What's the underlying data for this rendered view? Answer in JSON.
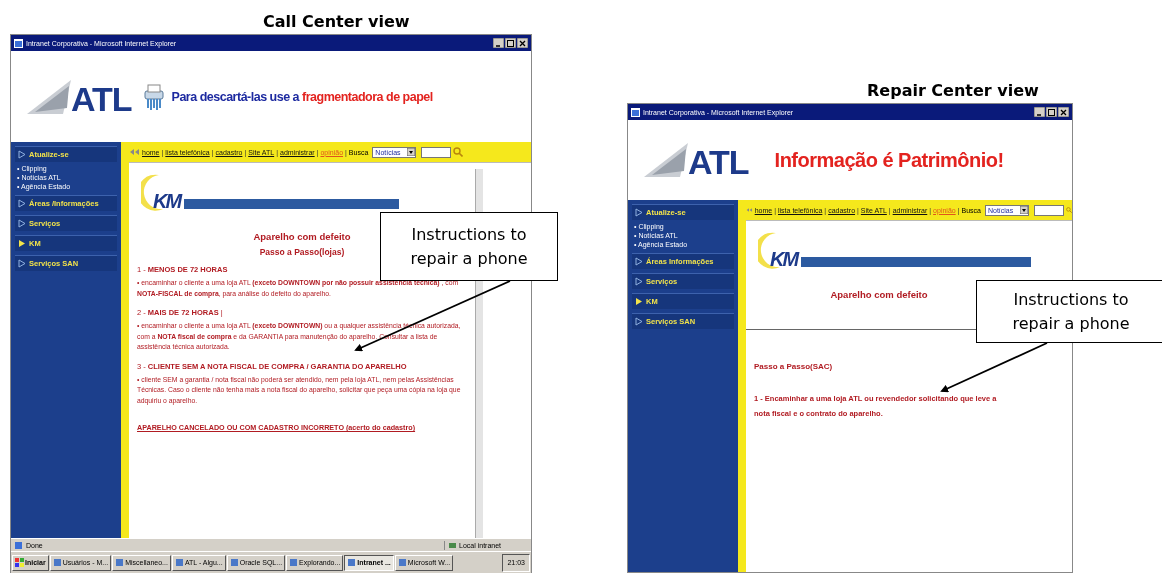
{
  "views": [
    {
      "caption": "Call Center  view",
      "window": {
        "title": "Intranet Corporativa - Microsoft Internet Explorer",
        "logo": "ATL",
        "banner": {
          "kind": "ad",
          "parts": [
            {
              "text": "Para descartá-las use a ",
              "color": "#1d2aa0"
            },
            {
              "text": "fragmentadora de papel",
              "color": "#e3231f"
            }
          ]
        },
        "sidebar": [
          {
            "label": "Atualize-se",
            "selected": false,
            "links": [
              "• Clipping",
              "• Notícias ATL",
              "• Agência Estado"
            ]
          },
          {
            "label": "Áreas /Informações",
            "selected": false
          },
          {
            "label": "Serviços",
            "selected": false
          },
          {
            "label": "KM",
            "selected": true
          },
          {
            "label": "Serviços SAN",
            "selected": false
          }
        ],
        "toolbar": {
          "separator": "|",
          "links": [
            {
              "text": "home",
              "kind": "plain"
            },
            {
              "text": "lista telefônica",
              "kind": "plain"
            },
            {
              "text": "cadastro",
              "kind": "plain"
            },
            {
              "text": "Site ATL",
              "kind": "plain"
            },
            {
              "text": "administrar",
              "kind": "plain"
            },
            {
              "text": "opinião",
              "kind": "accent"
            }
          ],
          "search_label": "Busca",
          "search_select": "Notícias"
        },
        "content": {
          "logo": "KM",
          "title": "Aparelho com defeito",
          "subtitle": "Passo a Passo(lojas)",
          "items": [
            {
              "kind": "heading",
              "text": "1 - **MENOS DE 72 HORAS**"
            },
            {
              "kind": "bullet",
              "text": "• encaminhar o cliente a uma loja ATL **(exceto DOWNTOWN por não possuir assistência técnica)** , com **NOTA-FISCAL de compra**, para análise do defeito do aparelho."
            },
            {
              "kind": "heading",
              "text": "2 - **MAIS DE 72 HORAS** |"
            },
            {
              "kind": "bullet",
              "text": "• encaminhar o cliente a uma loja ATL **(exceto DOWNTOWN)** ou a qualquer assistência técnica autorizada, com a **NOTA fiscal de compra** e da GARANTIA para manutenção do aparelho. Consultar a lista de assistência técnica autorizada."
            },
            {
              "kind": "heading",
              "text": "3 - **CLIENTE SEM A NOTA FISCAL DE COMPRA / GARANTIA DO APARELHO**"
            },
            {
              "kind": "bullet",
              "text": "• cliente SEM a garantia / nota fiscal não poderá ser atendido, nem pela loja ATL, nem pelas Assistências Técnicas. Caso o cliente não tenha mais a nota fiscal do aparelho, solicitar que peça uma cópia na loja que adquiriu o aparelho."
            }
          ],
          "link": "APARELHO CANCELADO OU COM CADASTRO INCORRETO (acerto do cadastro)"
        },
        "status_bar": {
          "text": "Done",
          "zone": "Local intranet"
        },
        "taskbar": {
          "start": "Iniciar",
          "clock": "21:03",
          "items": [
            {
              "label": "Usuários - M...",
              "selected": false
            },
            {
              "label": "Miscellaneo...",
              "selected": false
            },
            {
              "label": "ATL - Algu...",
              "selected": false
            },
            {
              "label": "Oracle SQL...",
              "selected": false
            },
            {
              "label": "Explorando...",
              "selected": false
            },
            {
              "label": "Intranet ...",
              "selected": true
            },
            {
              "label": "Microsoft W...",
              "selected": false
            }
          ]
        }
      }
    },
    {
      "caption": "Repair Center view",
      "window": {
        "title": "Intranet Corporativa - Microsoft Internet Explorer",
        "logo": "ATL",
        "banner": {
          "kind": "slogan",
          "parts": [
            {
              "text": "Informação é Patrimônio!",
              "color": "#e3231f"
            }
          ]
        },
        "sidebar": [
          {
            "label": "Atualize-se",
            "selected": false,
            "links": [
              "• Clipping",
              "• Notícias ATL",
              "• Agência Estado"
            ]
          },
          {
            "label": "Áreas Informações",
            "selected": false
          },
          {
            "label": "Serviços",
            "selected": false
          },
          {
            "label": "KM",
            "selected": true
          },
          {
            "label": "Serviços SAN",
            "selected": false
          }
        ],
        "toolbar": {
          "separator": "|",
          "links": [
            {
              "text": "home",
              "kind": "plain"
            },
            {
              "text": "lista telefônica",
              "kind": "plain"
            },
            {
              "text": "cadastro",
              "kind": "plain"
            },
            {
              "text": "Site ATL",
              "kind": "plain"
            },
            {
              "text": "administrar",
              "kind": "plain"
            },
            {
              "text": "opinião",
              "kind": "accent"
            }
          ],
          "search_label": "Busca",
          "search_select": "Notícias"
        },
        "content": {
          "logo": "KM",
          "title": "Aparelho com defeito",
          "items": [
            {
              "kind": "rule"
            },
            {
              "kind": "section",
              "text": "Passo a Passo(SAC)"
            },
            {
              "kind": "step",
              "text": "1 - Encaminhar a uma loja ATL ou revendedor solicitando que leve a nota fiscal e o contrato do aparelho."
            }
          ]
        }
      }
    }
  ],
  "callouts": [
    {
      "text": "Instructions to repair a phone"
    },
    {
      "text": "Instructions to repair a phone"
    }
  ]
}
